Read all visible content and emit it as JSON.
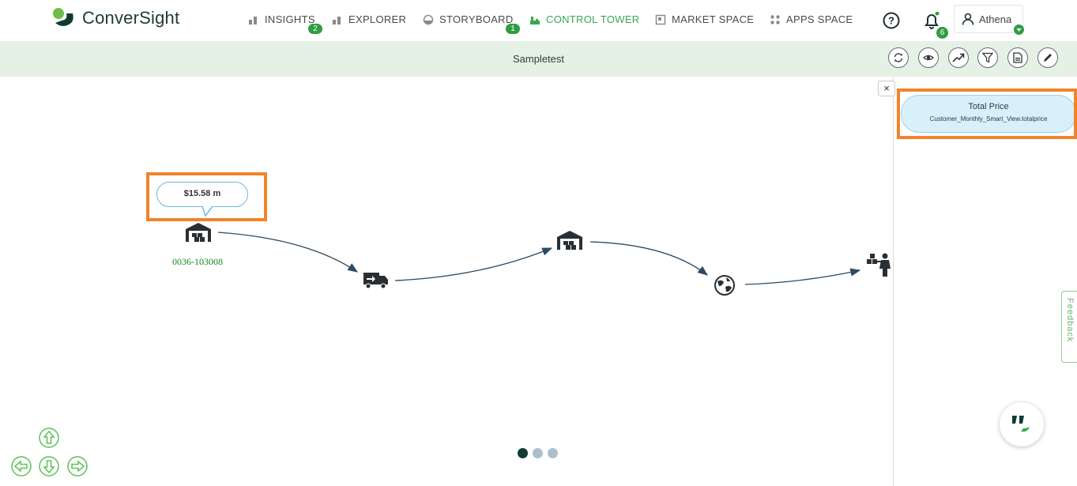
{
  "app": {
    "logo_text": "ConverSight"
  },
  "nav": {
    "items": [
      {
        "label": "INSIGHTS",
        "icon": "bar-chart-icon",
        "badge": "2"
      },
      {
        "label": "EXPLORER",
        "icon": "bar-chart-icon",
        "badge": ""
      },
      {
        "label": "STORYBOARD",
        "icon": "storyboard-icon",
        "badge": "1"
      },
      {
        "label": "CONTROL TOWER",
        "icon": "control-tower-icon",
        "badge": ""
      },
      {
        "label": "MARKET SPACE",
        "icon": "market-icon",
        "badge": ""
      },
      {
        "label": "APPS SPACE",
        "icon": "apps-grid-icon",
        "badge": ""
      }
    ],
    "active": "CONTROL TOWER"
  },
  "header": {
    "notification_count": "6",
    "user_name": "Athena"
  },
  "subheader": {
    "title": "Sampletest"
  },
  "toolbar": {
    "buttons": [
      "refresh-icon",
      "eye-icon",
      "trend-icon",
      "filter-icon",
      "document-icon",
      "edit-icon"
    ]
  },
  "flow": {
    "source_value": "$15.58 m",
    "source_label": "0036-103008",
    "nodes": [
      "warehouse-icon",
      "delivery-truck-icon",
      "warehouse-icon",
      "globe-icon",
      "customer-icon"
    ]
  },
  "panel": {
    "close_label": "×",
    "measure_title": "Total Price",
    "measure_field": "Customer_Monthly_Smart_View.totalprice"
  },
  "feedback": {
    "label": "Feedback"
  },
  "colors": {
    "accent_green": "#3aa655",
    "badge_green": "#2f9d42",
    "highlight_orange": "#f2832a",
    "subbar_bg": "#e6f1e5",
    "arrow_navy": "#2d4a63"
  }
}
